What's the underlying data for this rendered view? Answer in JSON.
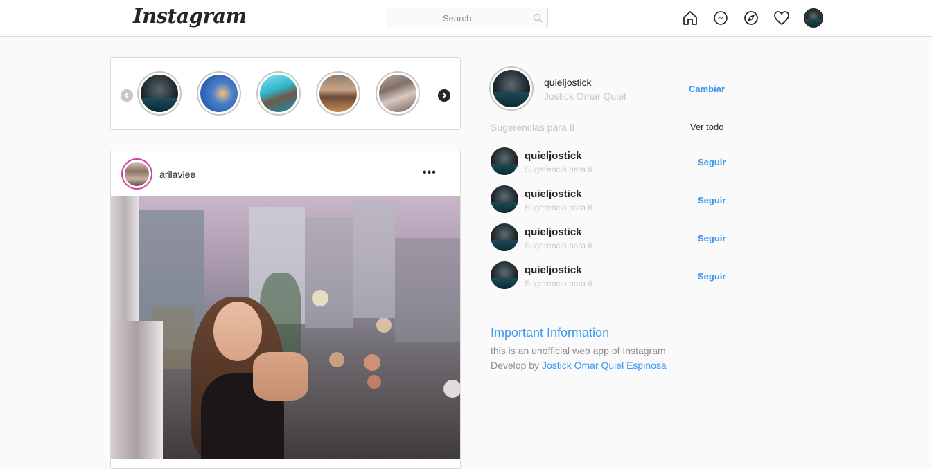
{
  "header": {
    "logo": "Instagram",
    "search_placeholder": "Search",
    "icons": [
      "home-icon",
      "messenger-icon",
      "explore-icon",
      "heart-icon",
      "profile-avatar"
    ]
  },
  "stories": {
    "count": 5
  },
  "post": {
    "username": "arilaviee",
    "more": "•••"
  },
  "sidebar": {
    "username": "quieljostick",
    "full_name": "Jostick Omar Quiel",
    "switch_label": "Cambiar",
    "suggestions_title": "Sugerencias para ti",
    "see_all_label": "Ver todo",
    "suggestions": [
      {
        "username": "quieljostick",
        "subtitle": "Sugerencia para ti",
        "follow": "Seguir"
      },
      {
        "username": "quieljostick",
        "subtitle": "Sugerencia para ti",
        "follow": "Seguir"
      },
      {
        "username": "quieljostick",
        "subtitle": "Sugerencia para ti",
        "follow": "Seguir"
      },
      {
        "username": "quieljostick",
        "subtitle": "Sugerencia para ti",
        "follow": "Seguir"
      }
    ]
  },
  "info": {
    "title": "Important Information",
    "text": "this is an unofficial web app of Instagram",
    "dev_prefix": "Develop by ",
    "dev_name": "Jostick Omar Quiel Espinosa"
  },
  "colors": {
    "accent": "#3897f0",
    "story_ring": "#c7c7c7",
    "post_ring": "#d63fa8",
    "text": "#262626"
  }
}
